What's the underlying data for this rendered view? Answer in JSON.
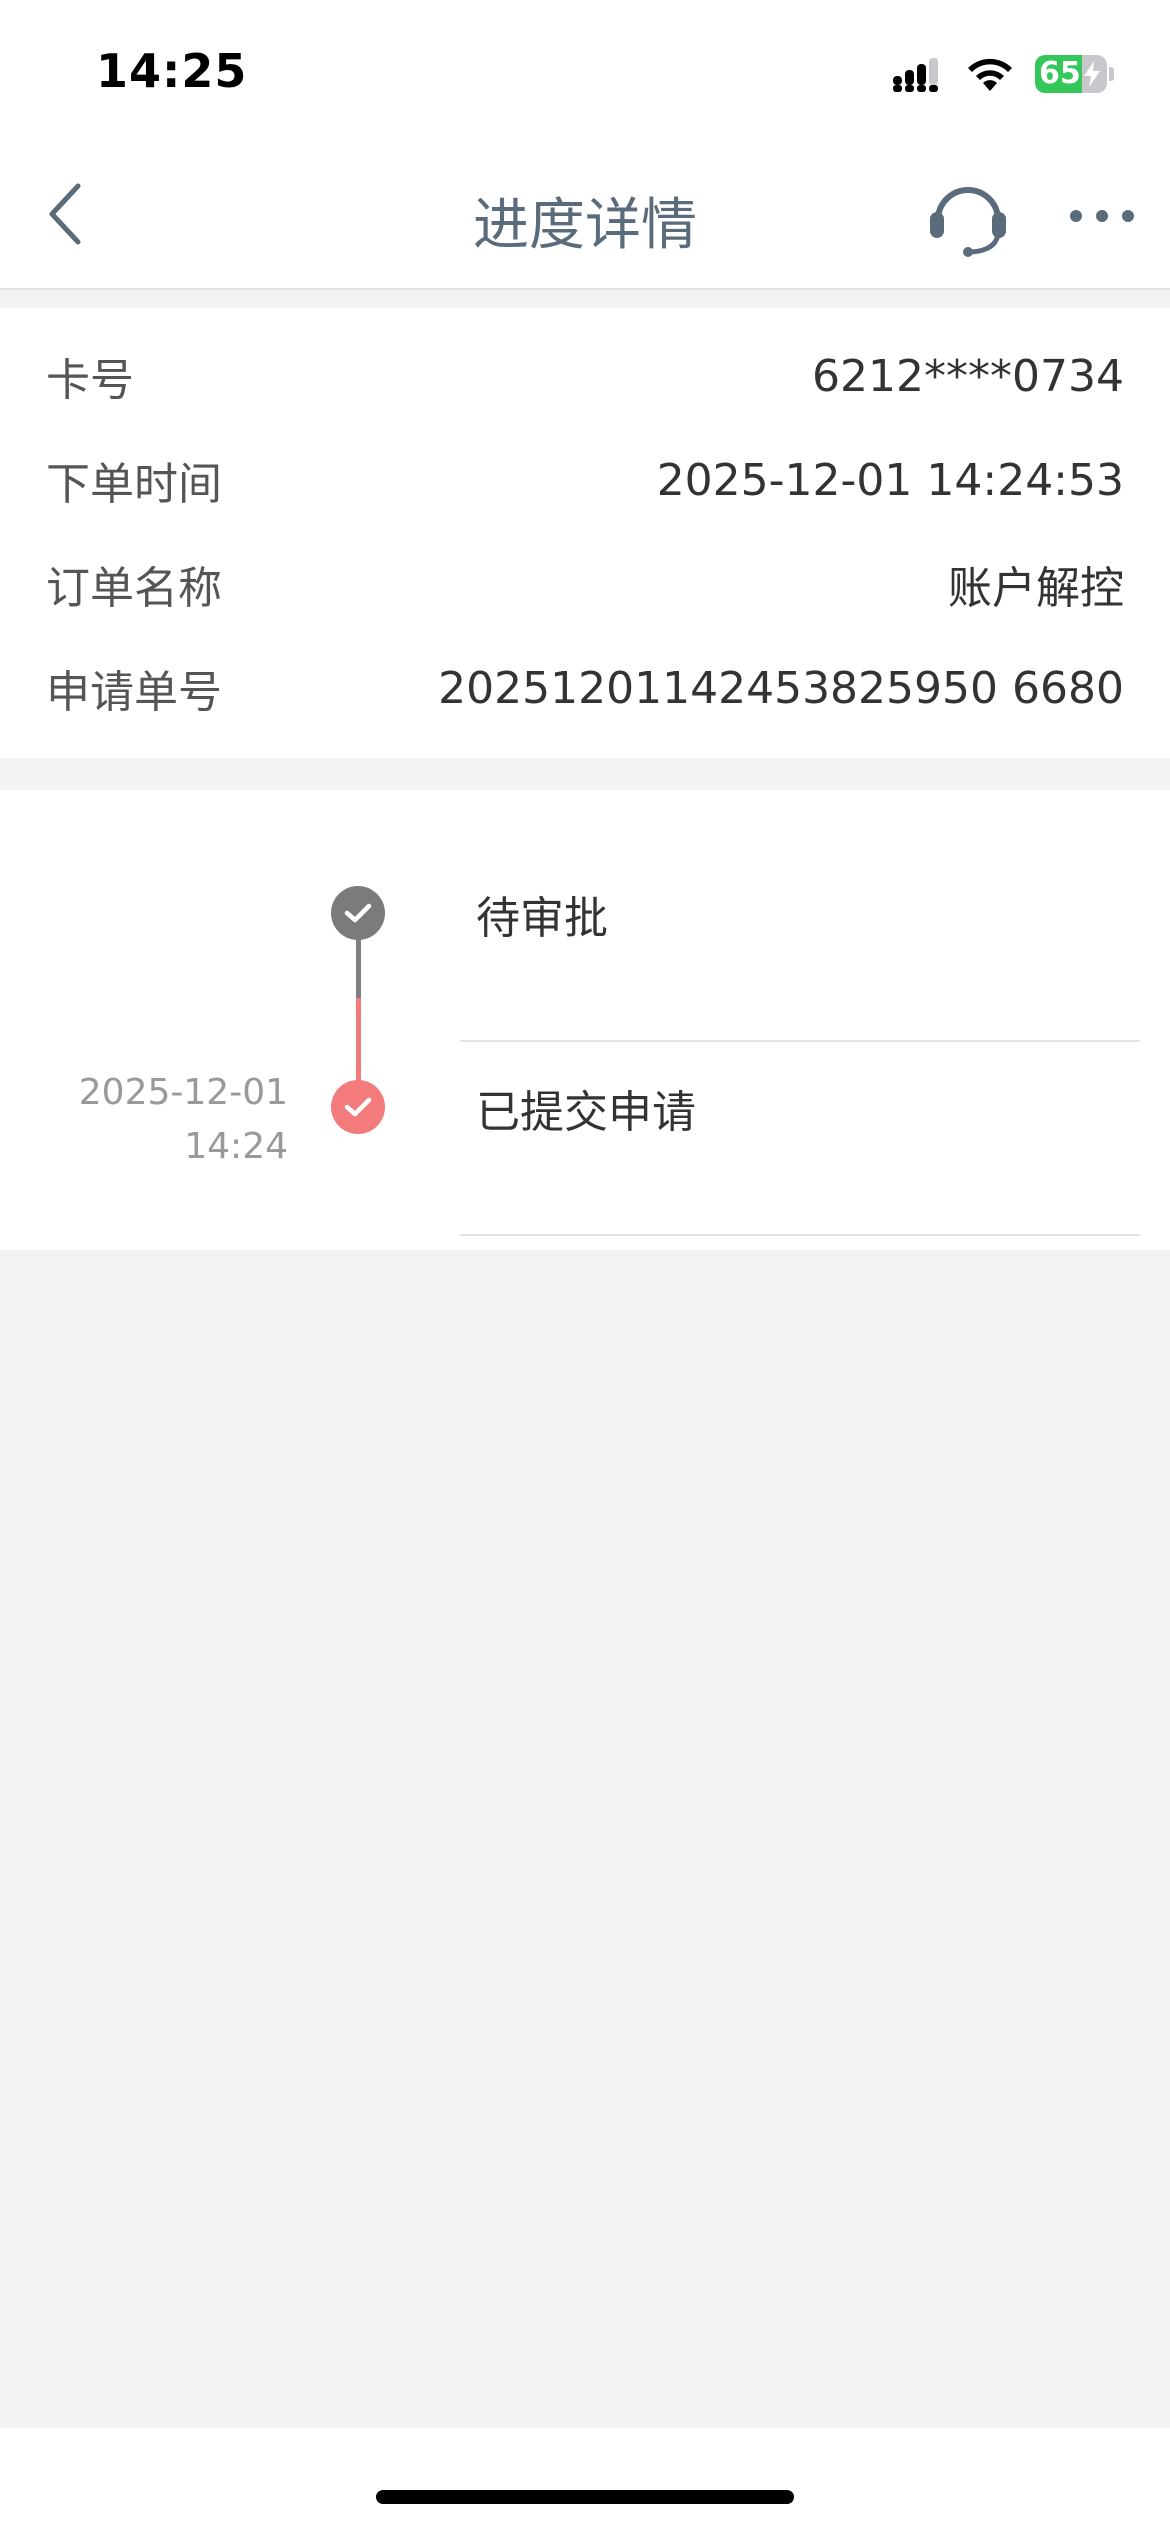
{
  "status_bar": {
    "time": "14:25",
    "battery_level": "65",
    "battery_fraction": 0.65,
    "signal_icon": "signal-icon",
    "wifi_icon": "wifi-icon"
  },
  "nav": {
    "title": "进度详情",
    "back_icon": "chevron-left-icon",
    "service_icon": "headset-icon",
    "more_icon": "more-horizontal-icon"
  },
  "info": {
    "rows": [
      {
        "label": "卡号",
        "value": "6212****0734"
      },
      {
        "label": "下单时间",
        "value": "2025-12-01 14:24:53"
      },
      {
        "label": "订单名称",
        "value": "账户解控"
      },
      {
        "label": "申请单号",
        "value": "20251201142453825950 6680"
      }
    ]
  },
  "timeline": {
    "steps": [
      {
        "title": "待审批",
        "date": "",
        "time": "",
        "status": "pending",
        "color": "#7b7b7b"
      },
      {
        "title": "已提交申请",
        "date": "2025-12-01",
        "time": "14:24",
        "status": "done",
        "color": "#f47b7b"
      }
    ]
  },
  "colors": {
    "accent_red": "#f47b7b",
    "nav_title": "#5a6b7b",
    "battery_green": "#34c759",
    "page_bg": "#f2f2f2"
  }
}
